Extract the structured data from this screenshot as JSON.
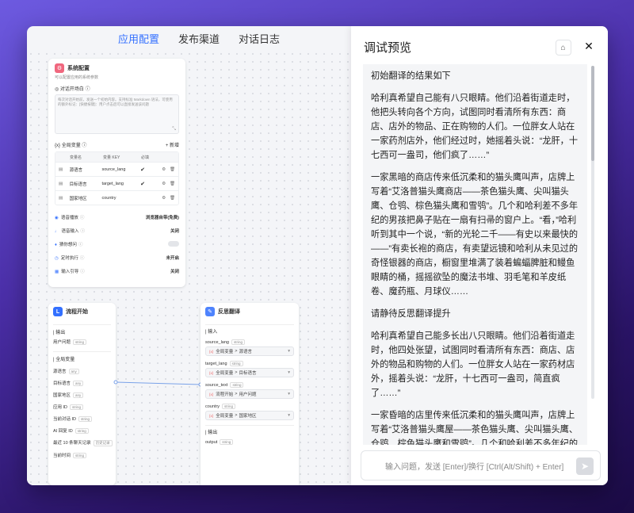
{
  "nav": {
    "tabs": [
      "应用配置",
      "发布渠道",
      "对话日志"
    ]
  },
  "config_node": {
    "title": "系统配置",
    "subtitle": "可以配置应用的系统参数",
    "opening": {
      "label": "对话开场白",
      "text": "每次对话开始前，发送一个初始内容。支持标准 Markdown 语法，可使用的额外标记：[快捷按键]：用户点击后可以直接发送该问题"
    },
    "vars": {
      "label": "全局变量",
      "add": "新增",
      "headers": [
        "变量名",
        "变量 KEY",
        "必填"
      ],
      "rows": [
        {
          "name": "源语言",
          "key": "source_lang",
          "required": "✔"
        },
        {
          "name": "目标语言",
          "key": "target_lang",
          "required": "✔"
        },
        {
          "name": "国家地区",
          "key": "country",
          "required": ""
        }
      ]
    },
    "settings": [
      {
        "label": "语音播放",
        "value": "浏览器自带(免费)"
      },
      {
        "label": "语音输入",
        "value": "关闭"
      },
      {
        "label": "猜你想问",
        "value": ""
      },
      {
        "label": "定时执行",
        "value": "未开启"
      },
      {
        "label": "输入引导",
        "value": "关闭"
      }
    ]
  },
  "start_node": {
    "title": "流程开始",
    "output_label": "输出",
    "output_item": {
      "name": "用户问题",
      "type": "string"
    },
    "globals_label": "全局变量",
    "globals": [
      {
        "name": "源语言",
        "type": "any"
      },
      {
        "name": "目标语言",
        "type": "any"
      },
      {
        "name": "国家地区",
        "type": "any"
      },
      {
        "name": "应用 ID",
        "type": "string"
      },
      {
        "name": "当前对话 ID",
        "type": "string"
      },
      {
        "name": "AI 回复 ID",
        "type": "string"
      },
      {
        "name": "最近 10 条聊天记录",
        "type": "历史记录"
      },
      {
        "name": "当前时间",
        "type": "string"
      }
    ]
  },
  "reflect_node": {
    "title": "反思翻译",
    "input_label": "输入",
    "inputs": [
      {
        "key": "source_lang",
        "type": "string",
        "path_a": "全局变量",
        "path_b": "源语言"
      },
      {
        "key": "target_lang",
        "type": "string",
        "path_a": "全局变量",
        "path_b": "目标语言"
      },
      {
        "key": "source_text",
        "type": "string",
        "path_a": "流程开始",
        "path_b": "用户问题"
      },
      {
        "key": "country",
        "type": "string",
        "path_a": "全局变量",
        "path_b": "国家地区"
      }
    ],
    "output_label": "输出",
    "output_item": {
      "name": "output",
      "type": "string"
    }
  },
  "panel": {
    "title": "调试预览",
    "messages": [
      "初始翻译的结果如下",
      "哈利真希望自己能有八只眼睛。他们沿着街道走时，他把头转向各个方向，试图同时看清所有东西：商店、店外的物品、正在购物的人们。一位胖女人站在一家药剂店外，他们经过时，她摇着头说：“龙肝，十七西可一盎司，他们疯了……”",
      "一家黑暗的商店传来低沉柔和的猫头鹰叫声，店牌上写着“艾洛普猫头鹰商店——茶色猫头鹰、尖叫猫头鹰、仓鸮、棕色猫头鹰和雪鸮”。几个和哈利差不多年纪的男孩把鼻子贴在一扇有扫帚的窗户上。“看，”哈利听到其中一个说，“新的光轮二千——有史以来最快的——”有卖长袍的商店，有卖望远镜和哈利从未见过的奇怪银器的商店，橱窗里堆满了装着蝙蝠脾脏和鳗鱼眼睛的桶，摇摇欲坠的魔法书堆、羽毛笔和羊皮纸卷、魔药瓶、月球仪……",
      "请静待反思翻译提升",
      "哈利真希望自己能多长出八只眼睛。他们沿着街道走时，他四处张望，试图同时看清所有东西：商店、店外的物品和购物的人们。一位胖女人站在一家药材店外，摇着头说：“龙肝，十七西可一盎司，简直疯了……”",
      "一家昏暗的店里传来低沉柔和的猫头鹰叫声，店牌上写着“艾洛普猫头鹰屋——茶色猫头鹰、尖叫猫头鹰、仓鸮、棕色猫头鹰和雪鸮”。几个和哈利差不多年纪的男孩把鼻子贴在一扇展示扫帚的窗户上。“看，”哈利听到其中一个说，“新的光轮2000——史上最快的——”有卖长袍的商店，有卖望远镜和哈利从未见过的奇怪银器的商店，橱窗里堆满了装着蝙蝠的脾脏和鳗鱼眼睛的桶，摇摇欲坠的魔法书堆、羽毛笔和羊皮纸卷、魔药瓶和月球仪……"
    ],
    "input_placeholder": "输入问题，发送 [Enter]/换行 [Ctrl(Alt/Shift) + Enter]"
  },
  "colors": {
    "accent": "#3370ff",
    "start_icon": "#3370ff",
    "reflect_icon": "#4e83fd",
    "config_icon": "#f0677e"
  }
}
